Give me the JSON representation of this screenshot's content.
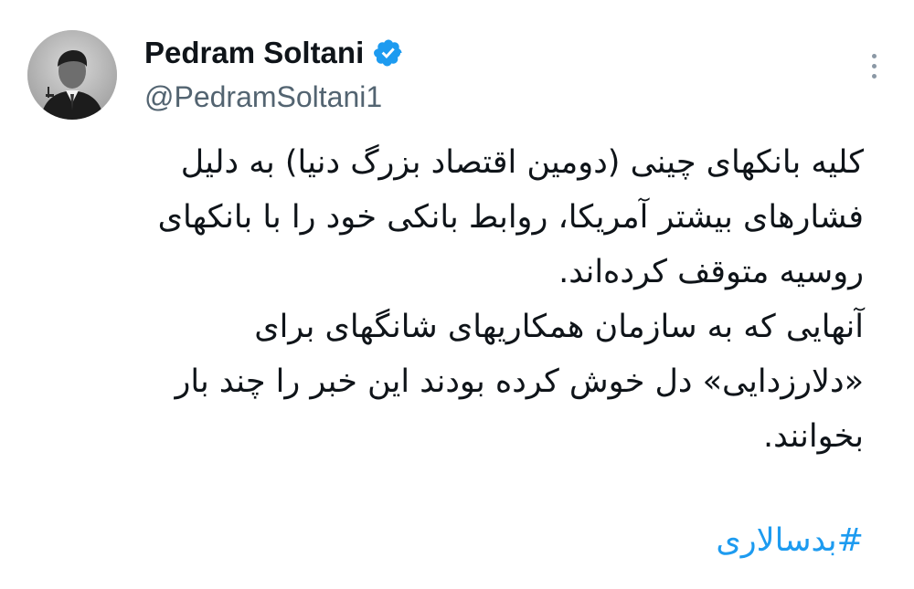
{
  "tweet": {
    "author": {
      "display_name": "Pedram Soltani",
      "handle": "@PedramSoltani1",
      "verified": true,
      "verified_icon": "verified-badge-icon",
      "avatar": "author-avatar"
    },
    "more_icon": "more-options-icon",
    "body_lines": [
      "کلیه بانکهای چینی (دومین اقتصاد بزرگ دنیا) به دلیل",
      "فشارهای بیشتر آمریکا، روابط بانکی خود را با بانکهای",
      "روسیه متوقف کرده‌اند.",
      "آنهایی که به سازمان همکاریهای شانگهای برای",
      "«دلارزدایی» دل خوش کرده بودند این خبر را چند بار",
      "بخوانند."
    ],
    "hashtag": "#بدسالاری",
    "colors": {
      "text": "#0f1419",
      "secondary": "#536471",
      "link": "#1d9bf0",
      "verified": "#1d9bf0"
    }
  }
}
